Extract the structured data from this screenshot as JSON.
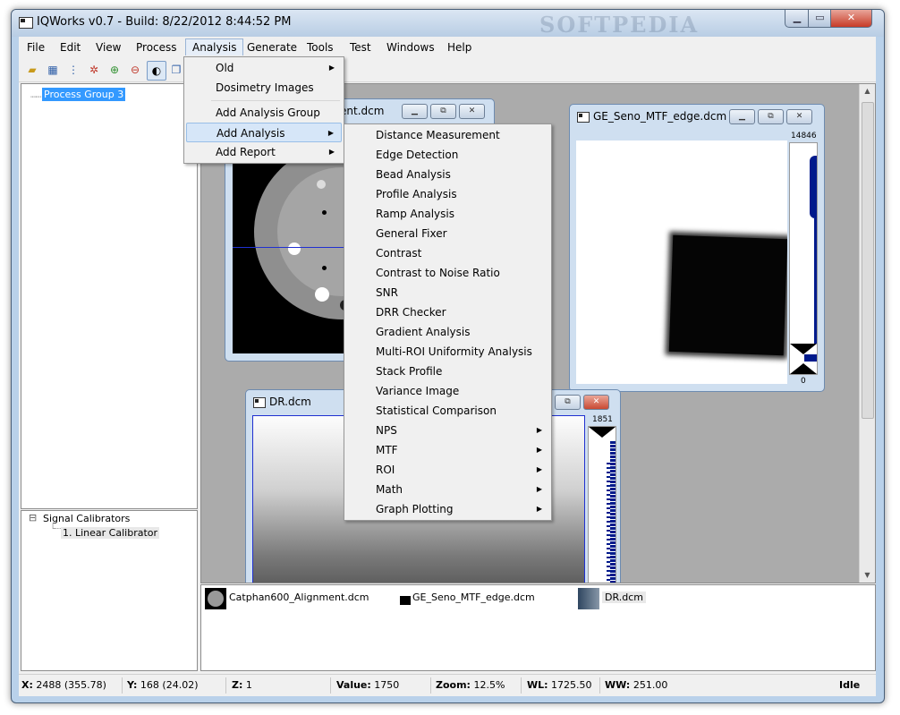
{
  "window": {
    "title": "IQWorks v0.7 - Build: 8/22/2012 8:44:52 PM",
    "watermark": "SOFTPEDIA"
  },
  "menubar": [
    "File",
    "Edit",
    "View",
    "Process",
    "Analysis",
    "Generate",
    "Tools",
    "Test",
    "Windows",
    "Help"
  ],
  "toolbar": [
    "open-folder-icon",
    "grid-icon",
    "tree-icon",
    "network-icon",
    "zoom-in-icon",
    "zoom-out-icon",
    "contrast-icon",
    "windows-icon"
  ],
  "tree_top": {
    "items": [
      "Process Group 3"
    ]
  },
  "tree_bottom": {
    "root": "Signal Calibrators",
    "child": "1. Linear Calibrator",
    "expander": "⊟"
  },
  "analysis_menu": {
    "items": [
      {
        "label": "Old",
        "submenu": true
      },
      {
        "label": "Dosimetry Images",
        "submenu": false
      },
      {
        "label": "Add Analysis Group",
        "submenu": false
      },
      {
        "label": "Add Analysis",
        "submenu": true
      },
      {
        "label": "Add Report",
        "submenu": true
      }
    ]
  },
  "add_analysis_menu": {
    "items": [
      {
        "label": "Distance Measurement",
        "submenu": false
      },
      {
        "label": "Edge Detection",
        "submenu": false
      },
      {
        "label": "Bead Analysis",
        "submenu": false
      },
      {
        "label": "Profile Analysis",
        "submenu": false
      },
      {
        "label": "Ramp Analysis",
        "submenu": false
      },
      {
        "label": "General Fixer",
        "submenu": false
      },
      {
        "label": "Contrast",
        "submenu": false
      },
      {
        "label": "Contrast to Noise Ratio",
        "submenu": false
      },
      {
        "label": "SNR",
        "submenu": false
      },
      {
        "label": "DRR Checker",
        "submenu": false
      },
      {
        "label": "Gradient Analysis",
        "submenu": false
      },
      {
        "label": "Multi-ROI Uniformity Analysis",
        "submenu": false
      },
      {
        "label": "Stack Profile",
        "submenu": false
      },
      {
        "label": "Variance Image",
        "submenu": false
      },
      {
        "label": "Statistical Comparison",
        "submenu": false
      },
      {
        "label": "NPS",
        "submenu": true
      },
      {
        "label": "MTF",
        "submenu": true
      },
      {
        "label": "ROI",
        "submenu": true
      },
      {
        "label": "Math",
        "submenu": true
      },
      {
        "label": "Graph Plotting",
        "submenu": true
      }
    ]
  },
  "windows": {
    "catphan": {
      "title": "ent.dcm"
    },
    "ge": {
      "title": "GE_Seno_MTF_edge.dcm",
      "hist_max": "14846",
      "hist_min": "0"
    },
    "dr": {
      "title": "DR.dcm",
      "hist_max": "1851"
    }
  },
  "thumbnails": [
    "Catphan600_Alignment.dcm",
    "GE_Seno_MTF_edge.dcm",
    "DR.dcm"
  ],
  "status": {
    "x_label": "X:",
    "x_value": "2488 (355.78)",
    "y_label": "Y:",
    "y_value": "168 (24.02)",
    "z_label": "Z:",
    "z_value": "1",
    "value_label": "Value:",
    "value_value": "1750",
    "zoom_label": "Zoom:",
    "zoom_value": "12.5%",
    "wl_label": "WL:",
    "wl_value": "1725.50",
    "ww_label": "WW:",
    "ww_value": "251.00",
    "state": "Idle"
  },
  "colors": {
    "accent": "#3399ff",
    "histogram": "#001a8c",
    "menu_highlight": "#d6e6f8"
  }
}
